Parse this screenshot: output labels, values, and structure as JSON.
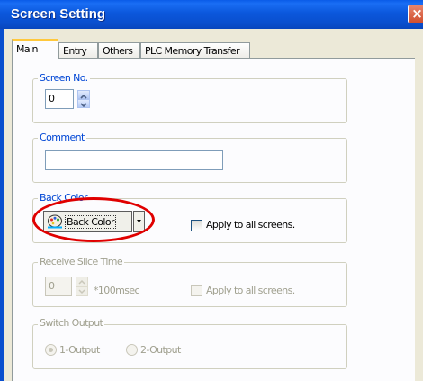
{
  "window": {
    "title": "Screen Setting",
    "close_glyph": "×"
  },
  "tabs": [
    {
      "label": "Main",
      "active": true
    },
    {
      "label": "Entry",
      "active": false
    },
    {
      "label": "Others",
      "active": false
    },
    {
      "label": "PLC Memory Transfer",
      "active": false
    }
  ],
  "screen_no": {
    "label": "Screen No.",
    "value": "0"
  },
  "comment": {
    "label": "Comment",
    "value": ""
  },
  "back_color": {
    "label": "Back Color",
    "button_label": "Back Color",
    "apply_label": "Apply to all screens.",
    "apply_checked": false
  },
  "receive_slice": {
    "label": "Receive Slice Time",
    "value": "0",
    "unit": "*100msec",
    "apply_label": "Apply to all screens.",
    "enabled": false
  },
  "switch_output": {
    "label": "Switch Output",
    "options": [
      "1-Output",
      "2-Output"
    ],
    "selected": "1-Output",
    "enabled": false
  },
  "annotation": {
    "highlight_color": "#e00000"
  },
  "colors": {
    "titlebar": "#0a4fce",
    "group_label": "#0046d5",
    "disabled_text": "#a0a08f",
    "tab_accent": "#ffc83c"
  }
}
